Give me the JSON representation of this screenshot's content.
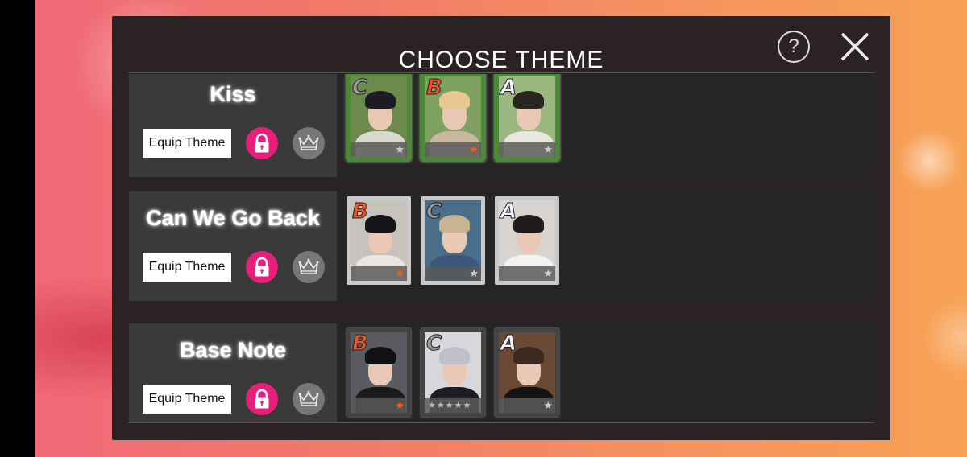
{
  "dialog": {
    "title": "CHOOSE THEME",
    "help_symbol": "?"
  },
  "themes": [
    {
      "name": "Kiss",
      "equip_label": "Equip Theme",
      "frame": "vine",
      "cards": [
        {
          "grade": "C",
          "rarity": "grey-star",
          "hair": "#1c1c22",
          "clothes": "#d8d8d0",
          "bg": "#6c8a4c"
        },
        {
          "grade": "B",
          "rarity": "orange-star",
          "hair": "#e8c890",
          "clothes": "#c8b8a0",
          "bg": "#7ea060"
        },
        {
          "grade": "A",
          "rarity": "grey-star",
          "hair": "#2a2420",
          "clothes": "#e8e8e0",
          "bg": "#9ab880"
        }
      ]
    },
    {
      "name": "Can We Go Back",
      "equip_label": "Equip Theme",
      "frame": "silver",
      "cards": [
        {
          "grade": "B",
          "rarity": "orange-star",
          "hair": "#141418",
          "clothes": "#e9e6e2",
          "bg": "#c8c2bc"
        },
        {
          "grade": "C",
          "rarity": "grey-star",
          "hair": "#c8b490",
          "clothes": "#3a5878",
          "bg": "#4a6e8a"
        },
        {
          "grade": "A",
          "rarity": "grey-star",
          "hair": "#201c1c",
          "clothes": "#f2f2f0",
          "bg": "#d8d4d0"
        }
      ]
    },
    {
      "name": "Base Note",
      "equip_label": "Equip Theme",
      "frame": "dark",
      "cards": [
        {
          "grade": "B",
          "rarity": "orange-star",
          "hair": "#111111",
          "clothes": "#1a1a1a",
          "bg": "#5a5a62"
        },
        {
          "grade": "C",
          "rarity": "five-stars",
          "hair": "#c0c0c8",
          "clothes": "#1e1e22",
          "bg": "#d8d8dc"
        },
        {
          "grade": "A",
          "rarity": "grey-star",
          "hair": "#3a2a20",
          "clothes": "#141414",
          "bg": "#6a4a36"
        }
      ]
    }
  ],
  "colors": {
    "lock": "#e81f7a",
    "crown": "#777777",
    "panel": "#2a2223"
  },
  "icons": [
    "help-icon",
    "close-icon",
    "lock-icon",
    "crown-icon",
    "star-icon"
  ]
}
